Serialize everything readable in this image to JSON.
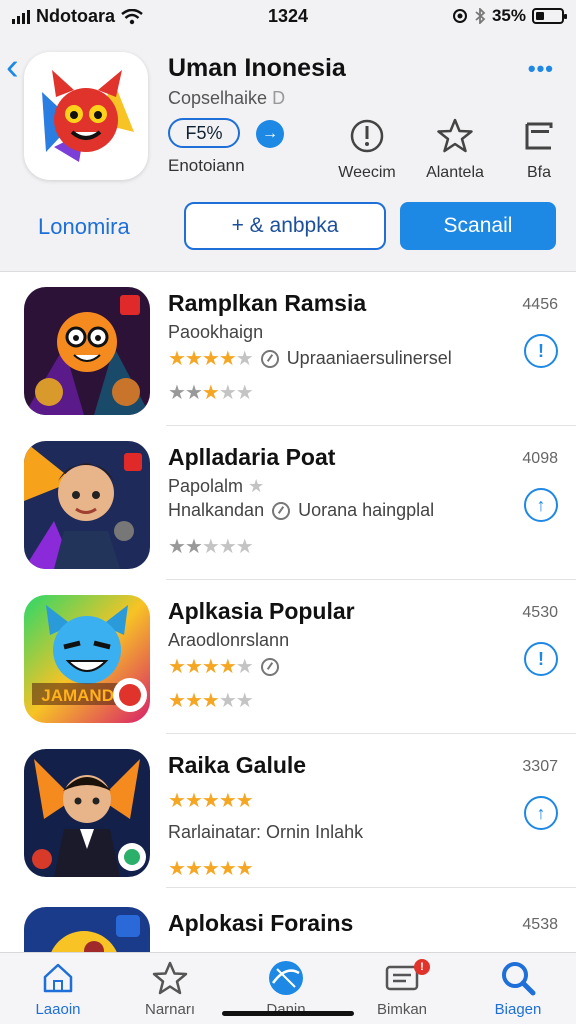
{
  "status": {
    "carrier": "Ndotoara",
    "time": "1324",
    "battery": "35%",
    "battery_level": 0.35
  },
  "header": {
    "title": "Uman Inonesia",
    "subtitle": "Copselhaike",
    "subtitle_icon": "D",
    "price": "F5%",
    "developer": "Enotoiann",
    "actions": [
      {
        "icon": "alert-icon",
        "label": "Weecim"
      },
      {
        "icon": "star-icon",
        "label": "Alantela"
      },
      {
        "icon": "bracket-icon",
        "label": "Bfa"
      }
    ],
    "tabs": {
      "left": "Lonomira",
      "middle": "+ & anbpka",
      "right": "Scanail"
    }
  },
  "apps": [
    {
      "title": "Ramplkan Ramsia",
      "sub": "Paookhaign",
      "count": "4456",
      "rating": 4,
      "line3": "Upraaniaersulinersel",
      "rating2": 3
    },
    {
      "title": "Aplladaria Poat",
      "sub": "Papolalm",
      "count": "4098",
      "rating": 1,
      "line3_left": "Hnalkandan",
      "line3": "Uorana haingplal",
      "rating2": 2
    },
    {
      "title": "Aplkasia Popular",
      "sub": "Araodlonrslann",
      "count": "4530",
      "rating": 4,
      "line3": "",
      "rating2": 3
    },
    {
      "title": "Raika Galule",
      "sub": "",
      "count": "3307",
      "rating": 5,
      "line3": "Rarlainatar: Ornin Inlahk",
      "rating2": 5
    },
    {
      "title": "Aplokasi Forains",
      "sub": "",
      "count": "4538",
      "rating": 0,
      "line3": "",
      "rating2": 0
    }
  ],
  "tabbar": [
    {
      "icon": "home-icon",
      "label": "Laaoin",
      "active": true
    },
    {
      "icon": "star-outline-icon",
      "label": "Narnarı",
      "active": false
    },
    {
      "icon": "globe-icon",
      "label": "Danin",
      "active": false
    },
    {
      "icon": "inbox-icon",
      "label": "Bimkan",
      "active": false
    },
    {
      "icon": "search-icon",
      "label": "Biagen",
      "active": true
    }
  ],
  "colors": {
    "accent": "#1e88e5",
    "star": "#f5a623",
    "header_bg": "#f2f2f4"
  }
}
